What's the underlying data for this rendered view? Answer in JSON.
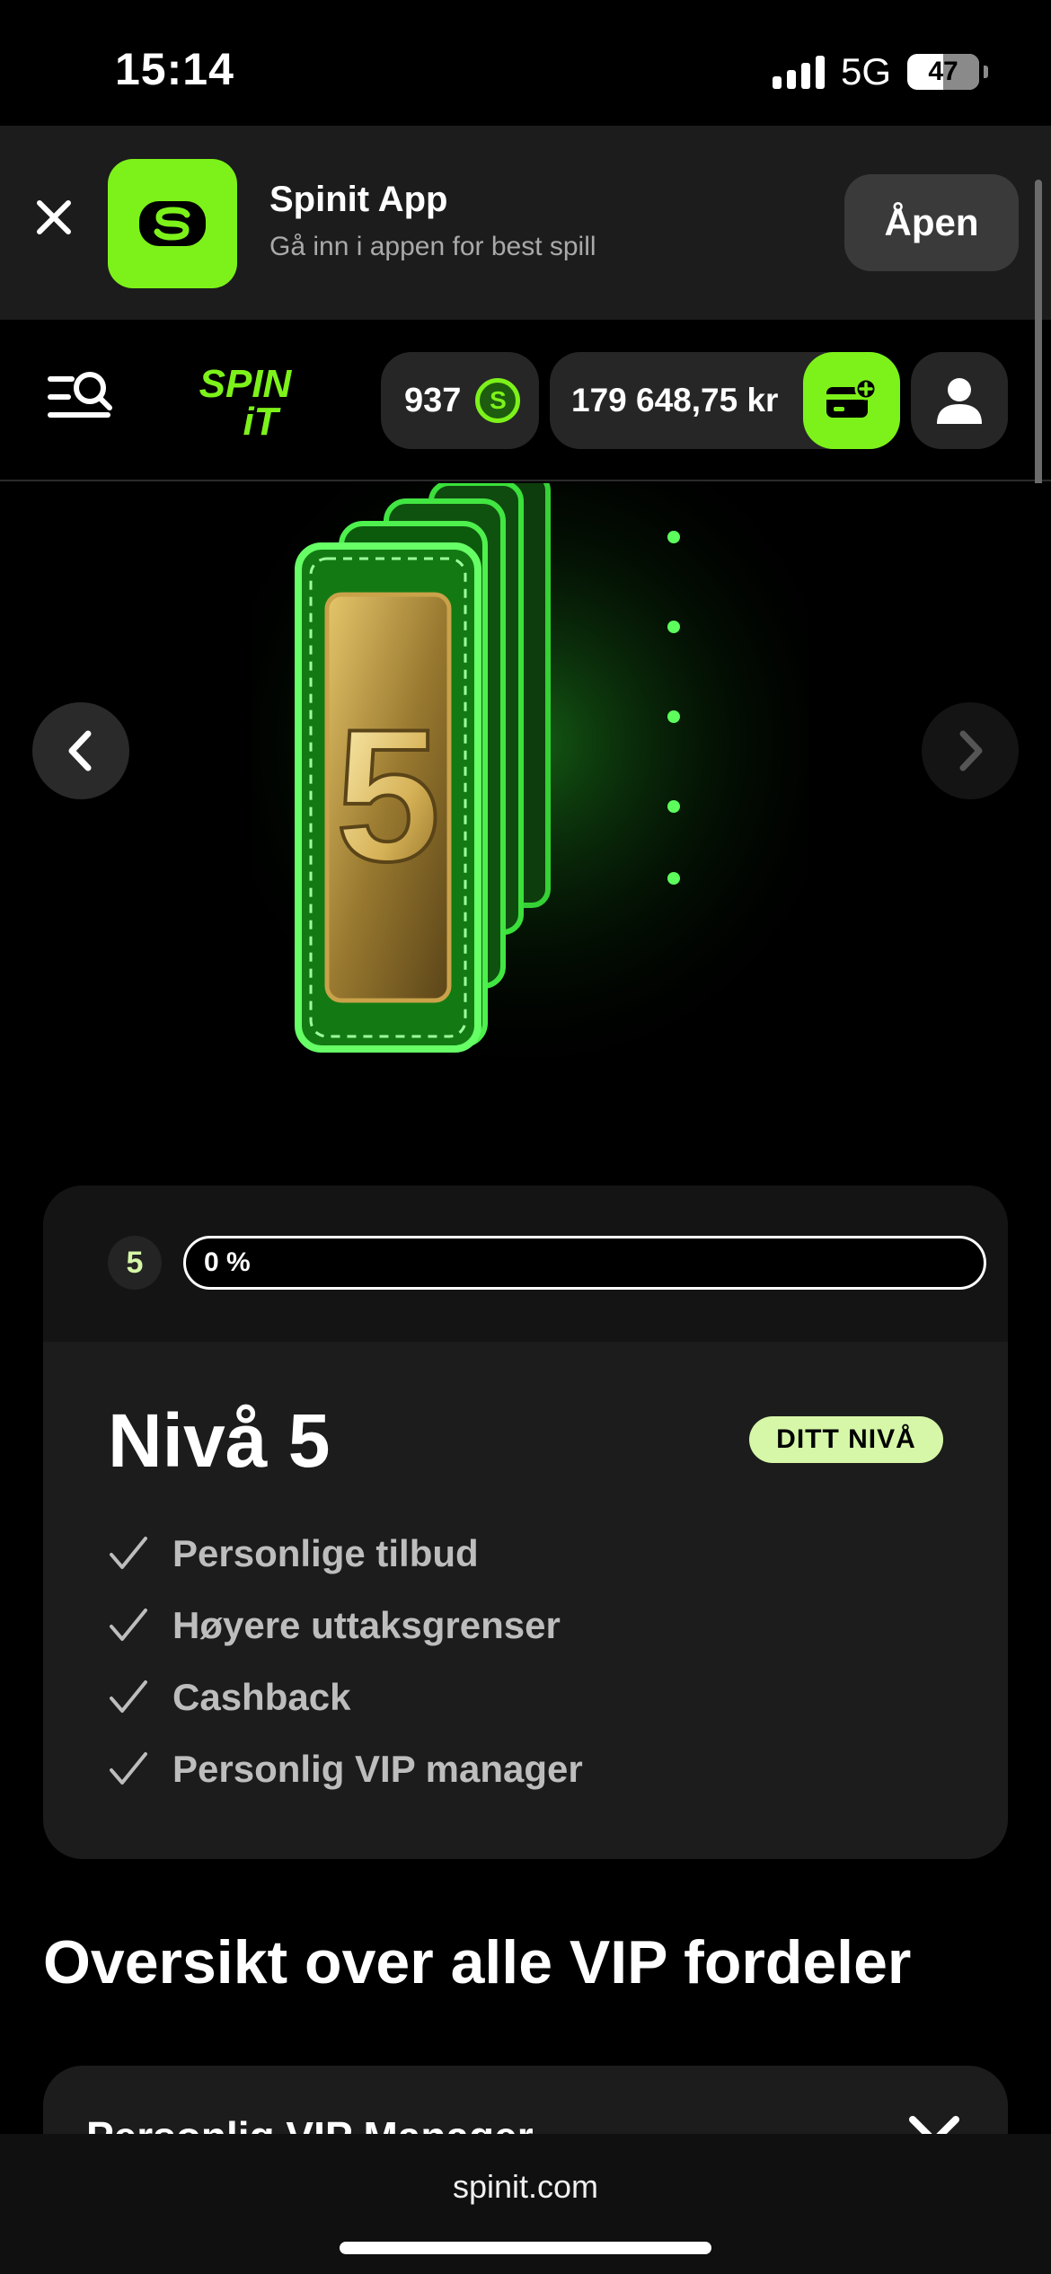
{
  "status_bar": {
    "time": "15:14",
    "network": "5G",
    "battery": "47"
  },
  "app_banner": {
    "app_name": "Spinit App",
    "subtitle": "Gå inn i appen for best spill",
    "open_label": "Åpen"
  },
  "header": {
    "logo_top": "SPIN",
    "logo_bottom": "iT",
    "coins": "937",
    "coin_symbol": "S",
    "balance": "179 648,75 kr"
  },
  "hero": {
    "level_number": "5"
  },
  "level_card": {
    "badge": "5",
    "progress_text": "0 %",
    "progress_fraction": 0,
    "title": "Nivå 5",
    "your_level": "DITT NIVÅ",
    "benefits": [
      "Personlige tilbud",
      "Høyere uttaksgrenser",
      "Cashback",
      "Personlig VIP manager"
    ]
  },
  "overview": {
    "title": "Oversikt over alle VIP fordeler",
    "accordion_label": "Personlig VIP Manager"
  },
  "browser": {
    "url": "spinit.com"
  },
  "colors": {
    "accent": "#7df21a",
    "badge_bg": "#d6f7a7",
    "card_bg": "#1c1c1c"
  }
}
